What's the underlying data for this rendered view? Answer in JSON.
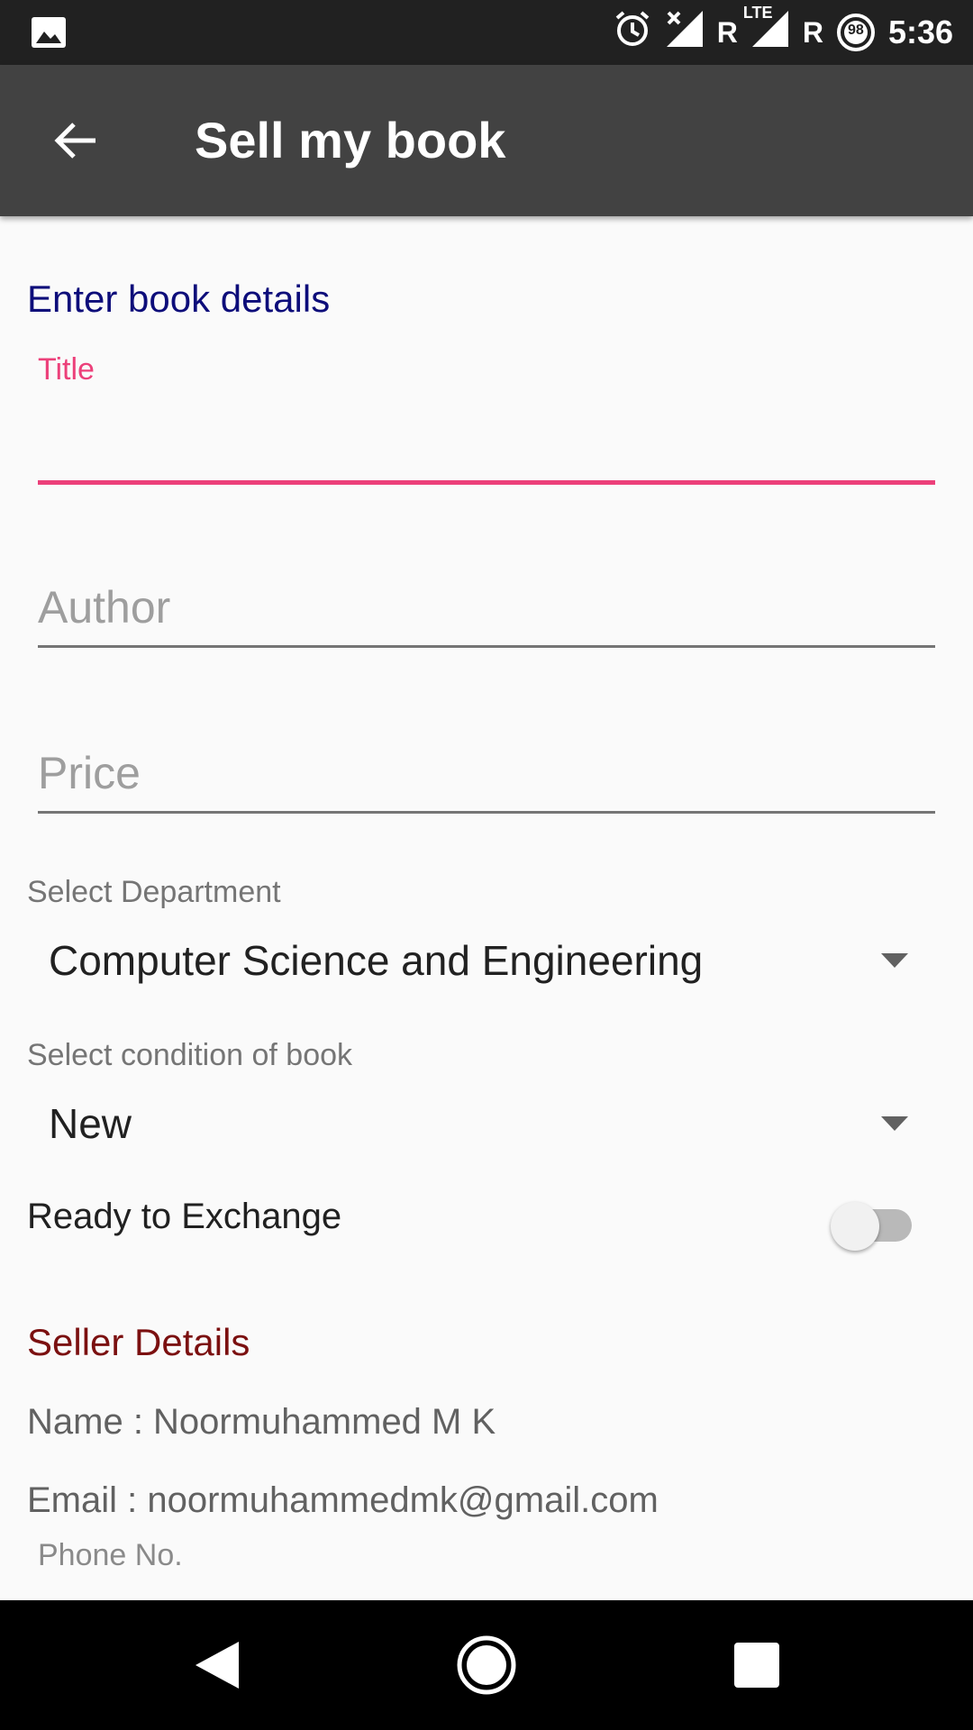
{
  "status_bar": {
    "icons": [
      "image-icon",
      "alarm-icon",
      "no-signal-icon",
      "lte-signal-icon",
      "battery-icon"
    ],
    "roaming_1": "R",
    "lte": "LTE",
    "roaming_2": "R",
    "battery": "98",
    "time": "5:36"
  },
  "app_bar": {
    "title": "Sell my book",
    "back_icon": "arrow-back-icon"
  },
  "form": {
    "section_title": "Enter book details",
    "title_field": {
      "label": "Title",
      "value": ""
    },
    "author_field": {
      "placeholder": "Author",
      "value": ""
    },
    "price_field": {
      "placeholder": "Price",
      "value": ""
    },
    "department": {
      "label": "Select Department",
      "selected": "Computer Science and Engineering"
    },
    "condition": {
      "label": "Select condition of book",
      "selected": "New"
    },
    "exchange": {
      "label": "Ready to Exchange",
      "enabled": false
    }
  },
  "seller": {
    "section_title": "Seller Details",
    "name_line": "Name : Noormuhammed M K",
    "email_line": "Email : noormuhammedmk@gmail.com",
    "phone_label": "Phone No."
  },
  "nav_bar": {
    "icons": [
      "nav-back-icon",
      "nav-home-icon",
      "nav-recents-icon"
    ]
  },
  "colors": {
    "accent": "#ec407a",
    "section_title": "#0d0d7a",
    "seller_title": "#7b1010",
    "app_bar": "#424242",
    "status_bar": "#212121"
  }
}
